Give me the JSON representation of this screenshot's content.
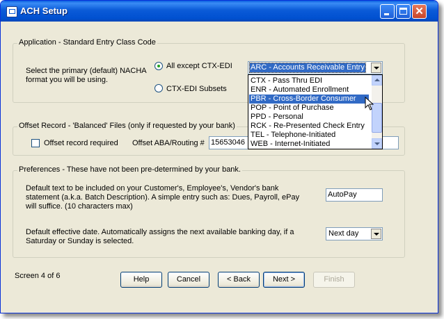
{
  "window": {
    "title": "ACH Setup"
  },
  "application": {
    "group_label": "Application - Standard Entry Class Code",
    "prompt": [
      "Select the primary (default) NACHA",
      "format you will be using."
    ],
    "radio_all_except": "All except CTX-EDI",
    "radio_ctx_subsets": "CTX-EDI Subsets",
    "selected_radio": "all_except",
    "sec_dropdown_value": "ARC - Accounts Receivable Entry",
    "sec_options": [
      "CTX - Pass Thru EDI",
      "ENR - Automated Enrollment",
      "PBR - Cross-Border Consumer",
      "POP - Point of Purchase",
      "PPD - Personal",
      "RCK - Re-Presented Check Entry",
      "TEL - Telephone-Initiated",
      "WEB - Internet-Initiated"
    ],
    "highlighted_option": "PBR - Cross-Border Consumer"
  },
  "offset": {
    "group_label": "Offset Record - 'Balanced' Files (only if requested by your bank)",
    "checkbox_label": "Offset record required",
    "checked": false,
    "routing_label": "Offset ABA/Routing #",
    "routing_value": "15653046"
  },
  "preferences": {
    "group_label": "Preferences - These have not been pre-determined by your bank.",
    "desc_text": [
      "Default text to be included on your Customer's, Employee's, Vendor's bank",
      "statement (a.k.a. Batch Description).  A simple entry such as: Dues, Payroll, ePay",
      "will suffice.  (10 characters max)"
    ],
    "desc_value": "AutoPay",
    "date_text": [
      "Default effective date.  Automatically assigns the next available banking day, if a",
      "Saturday or Sunday is selected."
    ],
    "date_value": "Next day"
  },
  "footer": {
    "screen_label": "Screen 4 of 6",
    "buttons": {
      "help": "Help",
      "cancel": "Cancel",
      "back": "< Back",
      "next": "Next >",
      "finish": "Finish"
    }
  },
  "colors": {
    "title_bar": "#0b5bd8",
    "selection": "#316ac5",
    "dialog_bg": "#ece9d8"
  },
  "icons": [
    "app-icon",
    "minimize-icon",
    "maximize-icon",
    "close-icon",
    "dropdown-arrow-icon",
    "mouse-pointer-icon"
  ]
}
